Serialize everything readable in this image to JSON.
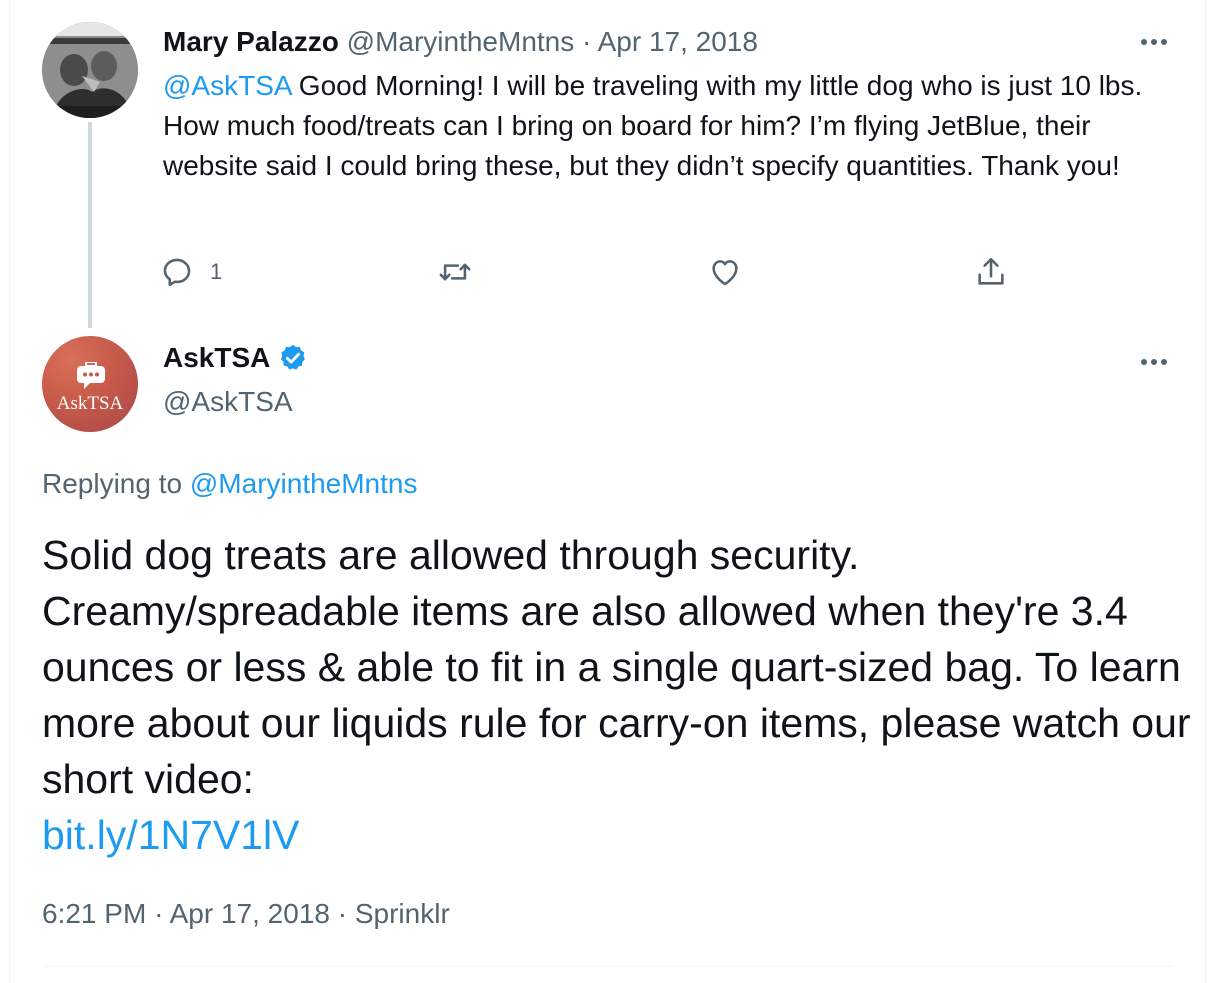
{
  "colors": {
    "link": "#1d9bf0",
    "text_primary": "#0f1419",
    "text_secondary": "#536471",
    "thread_line": "#cfd9de",
    "verified": "#1d9bf0"
  },
  "parent_tweet": {
    "display_name": "Mary Palazzo",
    "handle": "@MaryintheMntns",
    "separator": "·",
    "date": "Apr 17, 2018",
    "mention": "@AskTSA",
    "body": "Good Morning! I will be traveling with my little dog who is just 10 lbs. How much food/treats can I bring on board for him? I’m flying JetBlue, their website said I could bring these, but they didn’t specify quantities. Thank you!",
    "more_icon": "more-horizontal-icon",
    "actions": [
      {
        "icon": "reply-icon",
        "count": "1"
      },
      {
        "icon": "retweet-icon",
        "count": ""
      },
      {
        "icon": "like-icon",
        "count": ""
      },
      {
        "icon": "share-icon",
        "count": ""
      }
    ]
  },
  "reply_tweet": {
    "display_name": "AskTSA",
    "verified": true,
    "handle": "@AskTSA",
    "avatar_text": "AskTSA",
    "more_icon": "more-horizontal-icon",
    "replying_label": "Replying to",
    "replying_to": "@MaryintheMntns",
    "body": "Solid dog treats are allowed through security. Creamy/spreadable items are also allowed when they're 3.4 ounces or less & able to fit in a single quart-sized bag. To learn more about our liquids rule for carry-on items, please watch our short video:",
    "link": "bit.ly/1N7V1lV",
    "time": "6:21 PM",
    "separator": "·",
    "date": "Apr 17, 2018",
    "source": "Sprinklr"
  }
}
